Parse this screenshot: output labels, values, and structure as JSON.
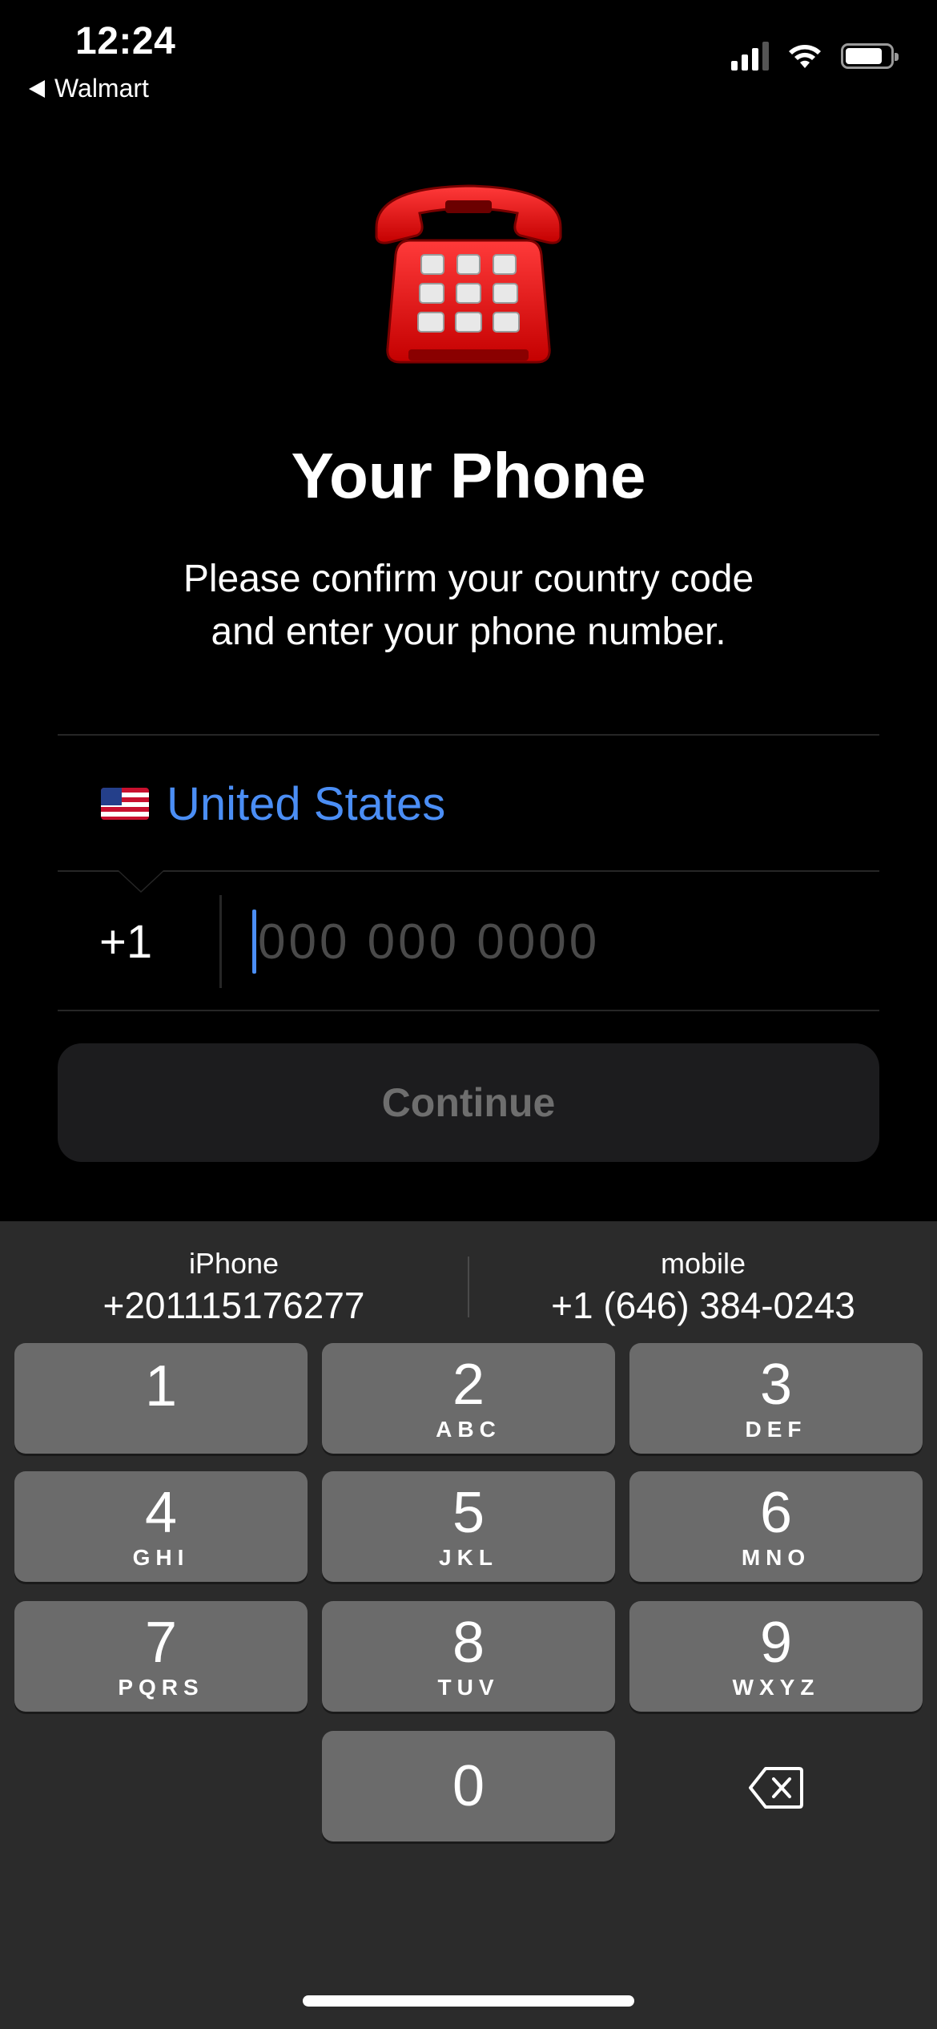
{
  "status_bar": {
    "time": "12:24",
    "back_app": "Walmart",
    "icons": [
      "cellular-signal-icon",
      "wifi-icon",
      "battery-icon"
    ]
  },
  "hero": {
    "icon": "telephone-icon",
    "title": "Your Phone",
    "subtitle_line1": "Please confirm your country code",
    "subtitle_line2": "and enter your phone number."
  },
  "form": {
    "country_flag": "us-flag-icon",
    "country_name": "United States",
    "country_code": "+1",
    "phone_value": "",
    "phone_placeholder": "000 000 0000",
    "continue_label": "Continue"
  },
  "keyboard": {
    "suggestions": [
      {
        "label": "iPhone",
        "number": "+201115176277"
      },
      {
        "label": "mobile",
        "number": "+1 (646) 384-0243"
      }
    ],
    "keys": [
      {
        "digit": "1",
        "letters": ""
      },
      {
        "digit": "2",
        "letters": "ABC"
      },
      {
        "digit": "3",
        "letters": "DEF"
      },
      {
        "digit": "4",
        "letters": "GHI"
      },
      {
        "digit": "5",
        "letters": "JKL"
      },
      {
        "digit": "6",
        "letters": "MNO"
      },
      {
        "digit": "7",
        "letters": "PQRS"
      },
      {
        "digit": "8",
        "letters": "TUV"
      },
      {
        "digit": "9",
        "letters": "WXYZ"
      },
      {
        "digit": "0",
        "letters": ""
      }
    ],
    "delete_icon": "delete-backspace-icon"
  },
  "colors": {
    "background": "#000000",
    "accent": "#4b8ef5",
    "keyboard_bg": "#2b2b2b",
    "key_bg": "#6b6b6b",
    "button_bg": "#1c1c1e"
  }
}
